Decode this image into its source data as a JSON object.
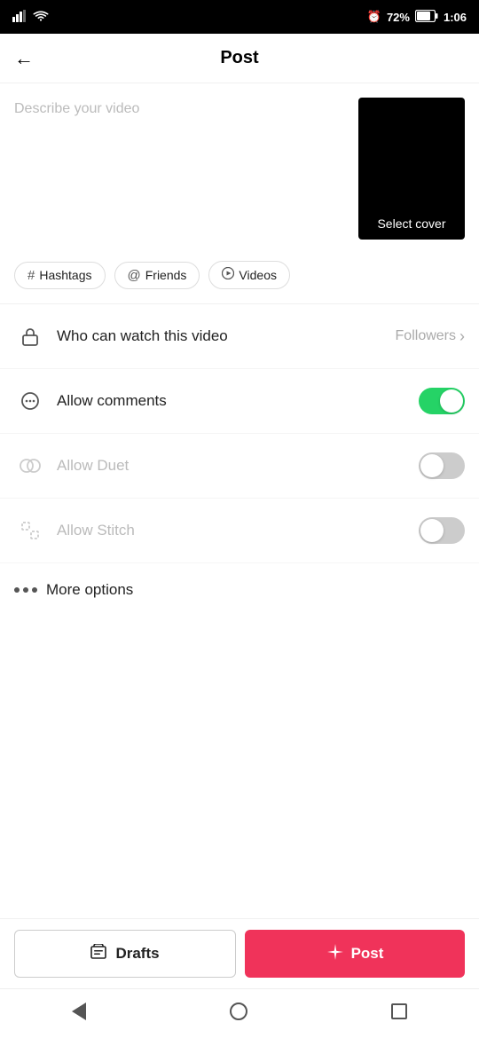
{
  "statusBar": {
    "signal": "📶",
    "wifi": "wifi",
    "alarm": "⏰",
    "battery": "72%",
    "time": "1:06"
  },
  "header": {
    "backLabel": "←",
    "title": "Post"
  },
  "videoArea": {
    "placeholder": "Describe your video",
    "selectCoverLabel": "Select cover"
  },
  "chips": [
    {
      "id": "hashtags",
      "icon": "#",
      "label": "Hashtags"
    },
    {
      "id": "friends",
      "icon": "@",
      "label": "Friends"
    },
    {
      "id": "videos",
      "icon": "▶",
      "label": "Videos"
    }
  ],
  "settings": [
    {
      "id": "who-can-watch",
      "label": "Who can watch this video",
      "value": "Followers",
      "hasChevron": true,
      "toggle": null,
      "disabled": false
    },
    {
      "id": "allow-comments",
      "label": "Allow comments",
      "value": null,
      "hasChevron": false,
      "toggle": "on",
      "disabled": false
    },
    {
      "id": "allow-duet",
      "label": "Allow Duet",
      "value": null,
      "hasChevron": false,
      "toggle": "off",
      "disabled": true
    },
    {
      "id": "allow-stitch",
      "label": "Allow Stitch",
      "value": null,
      "hasChevron": false,
      "toggle": "off",
      "disabled": true
    }
  ],
  "moreOptions": {
    "label": "More options"
  },
  "bottomButtons": {
    "draftsIcon": "🗂",
    "draftsLabel": "Drafts",
    "postIcon": "✳",
    "postLabel": "Post"
  }
}
